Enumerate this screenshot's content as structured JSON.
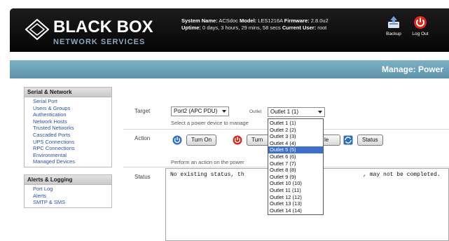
{
  "header": {
    "logo_title": "BLACK BOX",
    "logo_subtitle": "NETWORK SERVICES",
    "system_name_label": "System Name:",
    "system_name": "ACSdoc",
    "model_label": "Model:",
    "model": "LES1216A",
    "firmware_label": "Firmware:",
    "firmware": "2.8.0u2",
    "uptime_label": "Uptime:",
    "uptime": "0 days, 3 hours, 29 mins, 58 secs",
    "current_user_label": "Current User:",
    "current_user": "root",
    "backup_label": "Backup",
    "logout_label": "Log Out"
  },
  "titlebar": {
    "title": "Manage: Power"
  },
  "sidebar": {
    "sections": [
      {
        "title": "Serial & Network",
        "items": [
          "Serial Port",
          "Users & Groups",
          "Authentication",
          "Network Hosts",
          "Trusted Networks",
          "Cascaded Ports",
          "UPS Connections",
          "RPC Connections",
          "Environmental",
          "Managed Devices"
        ]
      },
      {
        "title": "Alerts & Logging",
        "items": [
          "Port Log",
          "Alerts",
          "SMTP & SMS"
        ]
      }
    ]
  },
  "form": {
    "target_label": "Target",
    "target_value": "Port2 (APC PDU)",
    "outlet_label": "Outlet",
    "outlet_value": "Outlet 1 (1)",
    "target_help": "Select a power device to manage",
    "action_label": "Action",
    "turn_on_label": "Turn On",
    "turn_off_label": "Turn",
    "cycle_label": "le",
    "status_button_label": "Status",
    "action_help": "Perform an action on the power",
    "status_label": "Status",
    "status_text_left": "No existing status, th",
    "status_text_right": ", may not be completed."
  },
  "outlet_options": [
    "Outlet 1 (1)",
    "Outlet 2 (2)",
    "Outlet 3 (3)",
    "Outlet 4 (4)",
    "Outlet 5 (5)",
    "Outlet 6 (6)",
    "Outlet 7 (7)",
    "Outlet 8 (8)",
    "Outlet 9 (9)",
    "Outlet 10 (10)",
    "Outlet 11 (11)",
    "Outlet 12 (12)",
    "Outlet 13 (13)",
    "Outlet 14 (14)"
  ],
  "outlet_highlighted_index": 4,
  "colors": {
    "accent": "#5c94ab",
    "link": "#2a52a8",
    "on": "#2b6fc9",
    "off": "#d42a1e"
  }
}
